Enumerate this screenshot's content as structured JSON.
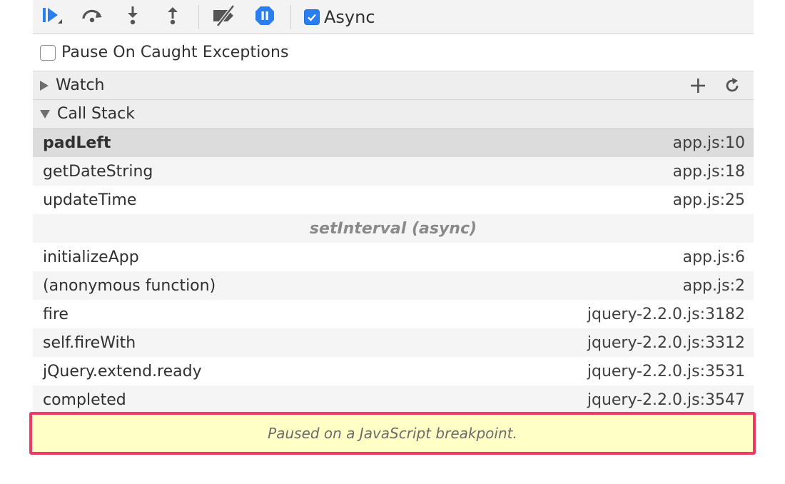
{
  "toolbar": {
    "buttons": [
      {
        "name": "resume-icon"
      },
      {
        "name": "step-over-icon"
      },
      {
        "name": "step-into-icon"
      },
      {
        "name": "step-out-icon"
      },
      {
        "name": "deactivate-breakpoints-icon"
      },
      {
        "name": "pause-on-exceptions-icon"
      }
    ],
    "async_label": "Async",
    "async_checked": true
  },
  "pause_caught": {
    "label": "Pause On Caught Exceptions",
    "checked": false
  },
  "watch": {
    "title": "Watch",
    "expanded": false,
    "add_icon": "plus-icon",
    "refresh_icon": "refresh-icon"
  },
  "call_stack": {
    "title": "Call Stack",
    "expanded": true,
    "frames": [
      {
        "function": "padLeft",
        "location": "app.js:10",
        "selected": true
      },
      {
        "function": "getDateString",
        "location": "app.js:18"
      },
      {
        "function": "updateTime",
        "location": "app.js:25"
      },
      {
        "async_label": "setInterval (async)"
      },
      {
        "function": "initializeApp",
        "location": "app.js:6"
      },
      {
        "function": "(anonymous function)",
        "location": "app.js:2"
      },
      {
        "function": "fire",
        "location": "jquery-2.2.0.js:3182"
      },
      {
        "function": "self.fireWith",
        "location": "jquery-2.2.0.js:3312"
      },
      {
        "function": "jQuery.extend.ready",
        "location": "jquery-2.2.0.js:3531"
      },
      {
        "function": "completed",
        "location": "jquery-2.2.0.js:3547"
      }
    ]
  },
  "status": {
    "message": "Paused on a JavaScript breakpoint."
  },
  "colors": {
    "accent_blue": "#2a7ff0",
    "highlight_border": "#f0386b",
    "status_background": "#ffffc6"
  }
}
